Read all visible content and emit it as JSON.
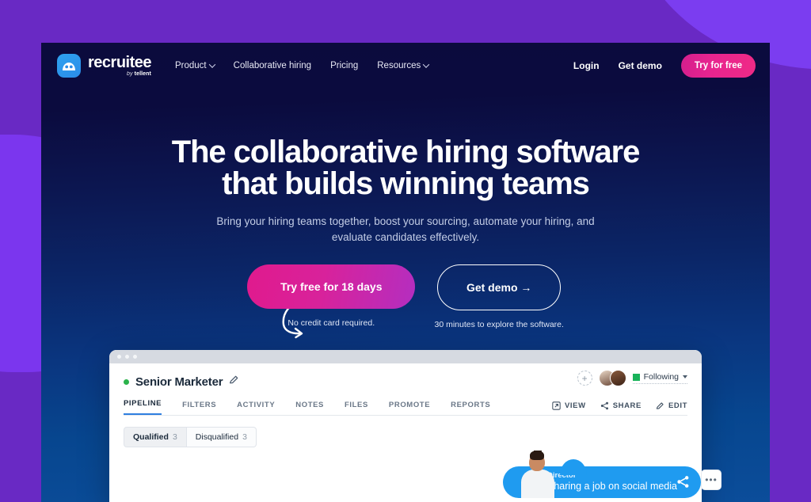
{
  "background": {
    "base_color": "#6929c4",
    "blob_color": "#7b36ee",
    "blob_topright_color": "#7b3df0"
  },
  "hero": {
    "gradient_top": "#0b0b3d",
    "gradient_bottom": "#0b4d9a",
    "title_line1": "The collaborative hiring software",
    "title_line2": "that builds winning teams",
    "subtitle_line1": "Bring your hiring teams together, boost your sourcing, automate your hiring, and",
    "subtitle_line2": "evaluate candidates effectively."
  },
  "nav": {
    "logo_word": "recruitee",
    "logo_sub_by": "by ",
    "logo_sub_brand": "tellent",
    "logo_icon": "cloud-people-icon",
    "links": [
      {
        "label": "Product",
        "has_caret": true
      },
      {
        "label": "Collaborative hiring",
        "has_caret": false
      },
      {
        "label": "Pricing",
        "has_caret": false
      },
      {
        "label": "Resources",
        "has_caret": true
      }
    ],
    "login_label": "Login",
    "get_demo_label": "Get demo",
    "try_free_label": "Try for free",
    "try_free_color": "#e8248f"
  },
  "cta": {
    "primary_label": "Try free for 18 days",
    "primary_note": "No credit card required.",
    "secondary_label": "Get demo →",
    "secondary_note": "30 minutes to explore the software."
  },
  "app_mock": {
    "window_dots": 3,
    "job_title": "Senior Marketer",
    "job_status": "open",
    "edit_icon": "pencil-icon",
    "add_person_icon": "plus-circle-dashed-icon",
    "following_label": "Following",
    "tabs": [
      {
        "label": "PIPELINE",
        "active": true
      },
      {
        "label": "FILTERS",
        "active": false
      },
      {
        "label": "ACTIVITY",
        "active": false
      },
      {
        "label": "NOTES",
        "active": false
      },
      {
        "label": "FILES",
        "active": false
      },
      {
        "label": "PROMOTE",
        "active": false
      },
      {
        "label": "REPORTS",
        "active": false
      }
    ],
    "actions": [
      {
        "label": "VIEW",
        "icon": "external-link-icon"
      },
      {
        "label": "SHARE",
        "icon": "share-nodes-icon"
      },
      {
        "label": "EDIT",
        "icon": "pencil-icon"
      }
    ],
    "segments": [
      {
        "label": "Qualified",
        "count": "3",
        "selected": true
      },
      {
        "label": "Disqualified",
        "count": "3",
        "selected": false
      }
    ],
    "callout": {
      "role": "Director",
      "message": "Sharing a job on social media",
      "icon": "share-nodes-icon",
      "color": "#1f9bf0"
    },
    "more_label": "•••"
  },
  "chat": {
    "icon": "chat-bubble-icon",
    "color": "#9e1f78"
  }
}
